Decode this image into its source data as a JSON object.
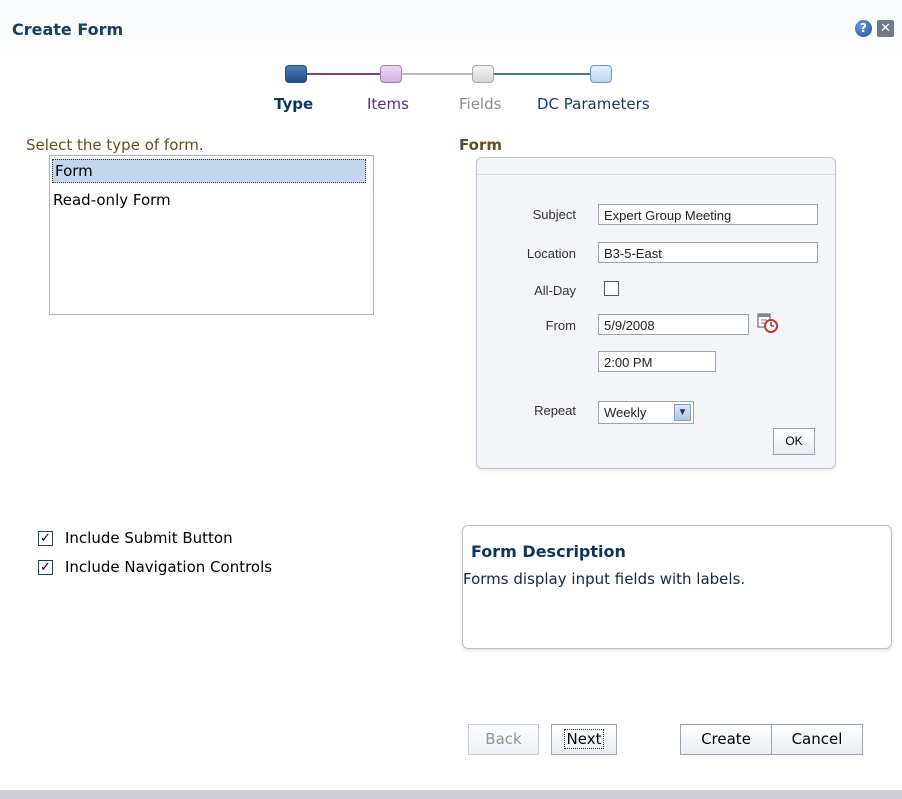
{
  "dialog": {
    "title": "Create Form",
    "help_icon": "help-icon",
    "close_icon": "close-icon"
  },
  "train": {
    "steps": [
      {
        "label": "Type",
        "state": "current",
        "color": "#1f4e86"
      },
      {
        "label": "Items",
        "state": "visited",
        "color": "#5a2a7d"
      },
      {
        "label": "Fields",
        "state": "disabled",
        "color": "#8d8d8d"
      },
      {
        "label": "DC Parameters",
        "state": "unvisited",
        "color": "#1a3c66"
      }
    ]
  },
  "type_select": {
    "label": "Select the type of form.",
    "options": [
      "Form",
      "Read-only Form"
    ],
    "selected": "Form"
  },
  "preview": {
    "heading": "Form",
    "subject_label": "Subject",
    "subject_value": "Expert Group Meeting",
    "location_label": "Location",
    "location_value": "B3-5-East",
    "allday_label": "All-Day",
    "allday_checked": false,
    "from_label": "From",
    "from_date": "5/9/2008",
    "from_time": "2:00 PM",
    "calendar_icon": "calendar-icon",
    "repeat_label": "Repeat",
    "repeat_value": "Weekly",
    "ok_label": "OK"
  },
  "options": {
    "include_submit": {
      "label": "Include Submit Button",
      "checked": true
    },
    "include_nav": {
      "label": "Include Navigation Controls",
      "checked": true
    }
  },
  "description": {
    "title": "Form Description",
    "text": "Forms display input fields with labels."
  },
  "buttons": {
    "back": "Back",
    "next": "Next",
    "create": "Create",
    "cancel": "Cancel"
  }
}
